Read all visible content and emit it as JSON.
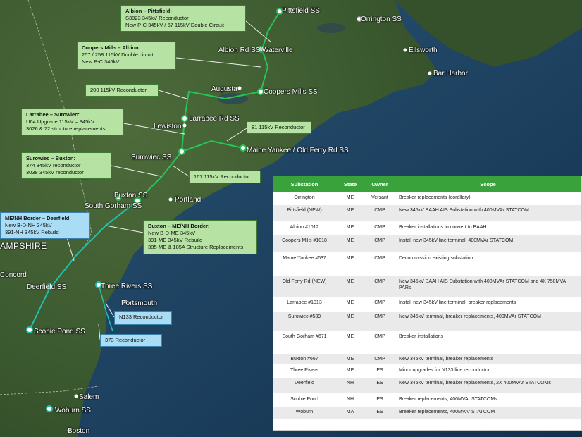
{
  "map": {
    "state_label_nh": "AMPSHIRE",
    "places": [
      {
        "id": "pittsfield",
        "name": "Pittsfield SS"
      },
      {
        "id": "orrington",
        "name": "Orrington SS"
      },
      {
        "id": "albion",
        "name": "Albion Rd SS"
      },
      {
        "id": "waterville",
        "name": "Waterville"
      },
      {
        "id": "ellsworth",
        "name": "Ellsworth"
      },
      {
        "id": "barharbor",
        "name": "Bar Harbor"
      },
      {
        "id": "augusta",
        "name": "Augusta"
      },
      {
        "id": "coopers",
        "name": "Coopers Mills SS"
      },
      {
        "id": "larrabee",
        "name": "Larrabee Rd SS"
      },
      {
        "id": "lewiston",
        "name": "Lewiston"
      },
      {
        "id": "surowiec",
        "name": "Surowiec SS"
      },
      {
        "id": "maineyankee",
        "name": "Maine Yankee / Old Ferry Rd SS"
      },
      {
        "id": "buxton",
        "name": "Buxton SS"
      },
      {
        "id": "southgorham",
        "name": "South Gorham SS"
      },
      {
        "id": "portland",
        "name": "Portland"
      },
      {
        "id": "concord",
        "name": "Concord"
      },
      {
        "id": "deerfield",
        "name": "Deerfield SS"
      },
      {
        "id": "threerivers",
        "name": "Three Rivers SS"
      },
      {
        "id": "portsmouth",
        "name": "Portsmouth"
      },
      {
        "id": "scobie",
        "name": "Scobie Pond SS"
      },
      {
        "id": "salem",
        "name": "Salem"
      },
      {
        "id": "woburn",
        "name": "Woburn SS"
      },
      {
        "id": "boston",
        "name": "Boston"
      }
    ]
  },
  "callouts": [
    {
      "id": "albion-pittsfield",
      "color": "green",
      "title": "Albion – Pittsfield:",
      "lines": [
        "S3023 345kV Reconductor",
        "New P-C 345kV / 67 115kV Double Circuit"
      ]
    },
    {
      "id": "coopers-albion",
      "color": "green",
      "title": "Coopers Mills – Albion:",
      "lines": [
        "257 / 258 115kV Double circuit",
        "New P-C 345kV"
      ]
    },
    {
      "id": "r200",
      "color": "green",
      "title": "",
      "lines": [
        "200 115kV Reconductor"
      ]
    },
    {
      "id": "larrabee-surowiec",
      "color": "green",
      "title": "Larrabee – Surowiec:",
      "lines": [
        "U64 Upgrade 115kV – 345kV",
        "3026 & 72 structure replacements"
      ]
    },
    {
      "id": "r81",
      "color": "green",
      "title": "",
      "lines": [
        "81 115kV Reconductor"
      ]
    },
    {
      "id": "surowiec-buxton",
      "color": "green",
      "title": "Surowiec – Buxton:",
      "lines": [
        "374 345kV reconductor",
        "3038 345kV reconductor"
      ]
    },
    {
      "id": "r167",
      "color": "green",
      "title": "",
      "lines": [
        "167 115kV Reconductor"
      ]
    },
    {
      "id": "menh-deerfield",
      "color": "blue",
      "title": "ME/NH Border – Deerfield:",
      "lines": [
        "New B-D-NH 345kV",
        "391-NH 345kV Rebuild"
      ]
    },
    {
      "id": "buxton-menh",
      "color": "green",
      "title": "Buxton – ME/NH Border:",
      "lines": [
        "New B-D-ME 345kV",
        "391-ME 345kV Rebuild",
        "385-ME & 185A Structure Replacements"
      ]
    },
    {
      "id": "n133",
      "color": "blue",
      "title": "",
      "lines": [
        "N133 Reconductor"
      ]
    },
    {
      "id": "r373",
      "color": "blue",
      "title": "",
      "lines": [
        "373 Reconductor"
      ]
    }
  ],
  "table": {
    "headers": [
      "Substation",
      "State",
      "Owner",
      "Scope"
    ],
    "rows": [
      [
        "Orrington",
        "ME",
        "Versant",
        "Breaker replacements (corollary)"
      ],
      [
        "Pittsfield (NEW)",
        "ME",
        "CMP",
        "New 345kV BAAH AIS Substation with 400MVAr STATCOM"
      ],
      [
        "Albion #1012",
        "ME",
        "CMP",
        "Breaker installations to convert to BAAH"
      ],
      [
        "Coopers Mills #1018",
        "ME",
        "CMP",
        "Install new 345kV line terminal, 400MVAr STATCOM"
      ],
      [
        "Maine Yankee #637",
        "ME",
        "CMP",
        "Decommission existing substation"
      ],
      [
        "Old Ferry Rd (NEW)",
        "ME",
        "CMP",
        "New 345kV BAAH AIS Substation with 400MVAr STATCOM and 4X 750MVA PARs"
      ],
      [
        "Larrabee #1013",
        "ME",
        "CMP",
        "Install new 345kV line terminal, breaker replacements"
      ],
      [
        "Surowiec #539",
        "ME",
        "CMP",
        "New 345kV terminal, breaker replacements, 400MVAr STATCOM"
      ],
      [
        "South Gorham #671",
        "ME",
        "CMP",
        "Breaker installations"
      ],
      [
        "Buxton #667",
        "ME",
        "CMP",
        "New 345kV terminal, breaker replacements"
      ],
      [
        "Three Rivers",
        "ME",
        "ES",
        "Minor upgrades for N133 line reconductor"
      ],
      [
        "Deerfield",
        "NH",
        "ES",
        "New 345kV terminal, breaker replacements, 2X 400MVAr STATCOMs"
      ],
      [
        "Scobie Pond",
        "NH",
        "ES",
        "Breaker replacements, 400MVAr STATCOMs"
      ],
      [
        "Woburn",
        "MA",
        "ES",
        "Breaker replacements, 400MVAr STATCOM"
      ]
    ]
  },
  "colors": {
    "callout_green": "#b6e3a3",
    "callout_blue": "#a9dcf5",
    "header_green": "#3aa23a",
    "line_green": "#28c45a",
    "line_teal": "#21c1b0"
  }
}
